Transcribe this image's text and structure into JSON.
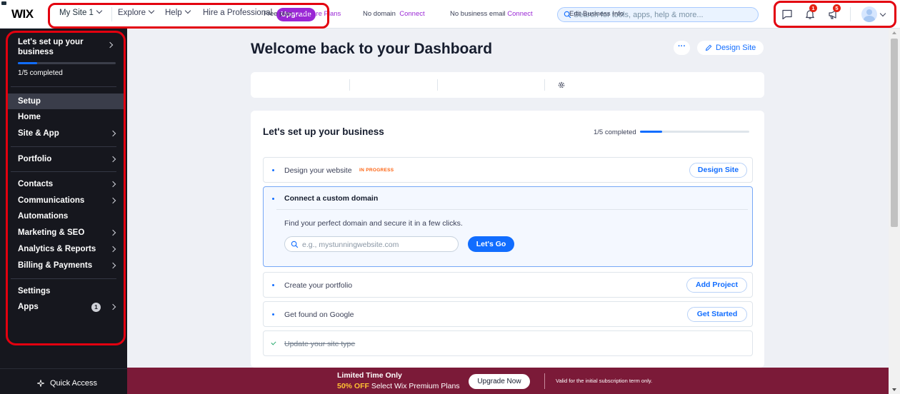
{
  "topbar": {
    "logo": "WIX",
    "site_selector": "My Site 1",
    "nav": [
      "Explore",
      "Help",
      "Hire a Professional"
    ],
    "upgrade_label": "Upgrade",
    "search_placeholder": "Search for tools, apps, help & more...",
    "notifications_count": "1",
    "announcements_count": "5"
  },
  "sidebar": {
    "setup_title": "Let's set up your business",
    "completed": "1/5 completed",
    "progress": 0.2,
    "items": [
      {
        "label": "Setup"
      },
      {
        "label": "Home"
      },
      {
        "label": "Site & App"
      },
      {
        "label": "Portfolio"
      },
      {
        "label": "Contacts"
      },
      {
        "label": "Communications"
      },
      {
        "label": "Automations"
      },
      {
        "label": "Marketing & SEO"
      },
      {
        "label": "Analytics & Reports"
      },
      {
        "label": "Billing & Payments"
      },
      {
        "label": "Settings"
      },
      {
        "label": "Apps",
        "badge": "1"
      }
    ],
    "quick_access": "Quick Access"
  },
  "main": {
    "title": "Welcome back to Dashboard",
    "title_full": "Welcome back to your Dashboard",
    "more_label": "···",
    "design_site": "Design Site",
    "infobar": {
      "plan": "Free plan",
      "compare": "Compare Plans",
      "domain": "No domain",
      "domain_link": "Connect",
      "email": "No business email",
      "email_link": "Connect",
      "edit": "Edit Business Info"
    },
    "setup_card": {
      "title": "Let's set up your business",
      "completed": "1/5 completed",
      "progress": 0.2,
      "tasks": [
        {
          "label": "Design your website",
          "status": "IN PROGRESS",
          "button": "Design Site"
        },
        {
          "label": "Connect a custom domain",
          "description": "Find your perfect domain and secure it in a few clicks.",
          "input_placeholder": "e.g., mystunningwebsite.com",
          "button": "Let's Go"
        },
        {
          "label": "Create your portfolio",
          "button": "Add Project"
        },
        {
          "label": "Get found on Google",
          "button": "Get Started"
        },
        {
          "label": "Update your site type",
          "done": true
        }
      ]
    }
  },
  "promo": {
    "line1": "Limited Time Only",
    "off": "50% OFF",
    "line2_rest": " Select Wix Premium Plans",
    "button": "Upgrade Now",
    "note": "Valid for the initial subscription term only."
  },
  "colors": {
    "accent": "#116dff",
    "upgrade": "#9a27d5",
    "sidebar_bg": "#16171e",
    "promo_bg": "#7b1a38",
    "highlight": "#e3000f",
    "in_progress": "#fe620f"
  }
}
